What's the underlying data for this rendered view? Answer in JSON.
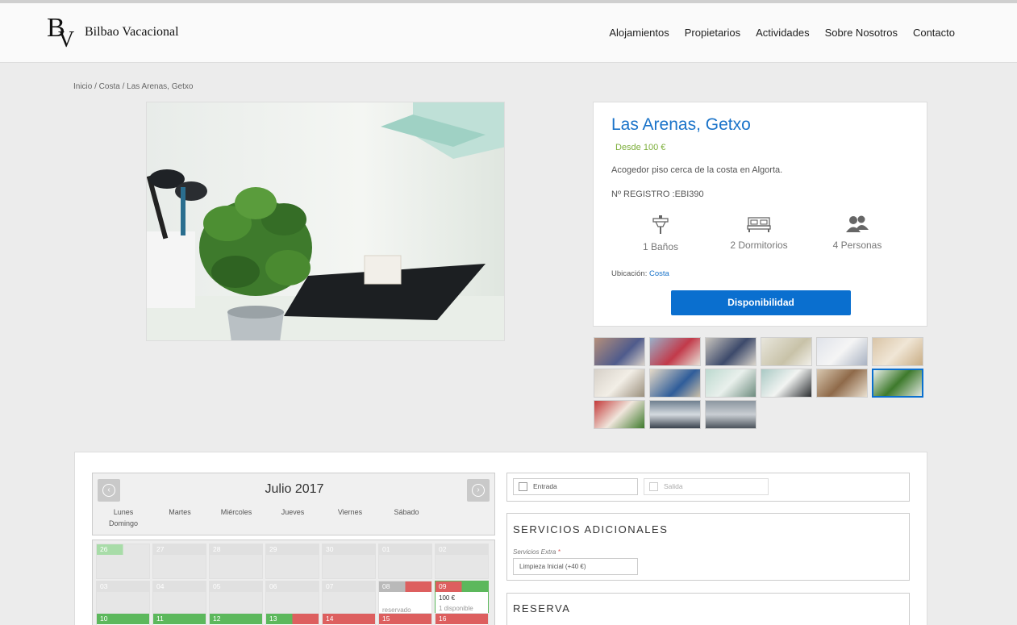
{
  "brand": {
    "logo_letters": "BV",
    "name": "Bilbao Vacacional"
  },
  "nav": [
    "Alojamientos",
    "Propietarios",
    "Actividades",
    "Sobre Nosotros",
    "Contacto"
  ],
  "breadcrumb": "Inicio / Costa / Las Arenas, Getxo",
  "property": {
    "title": "Las Arenas, Getxo",
    "price": "Desde 100 €",
    "description": "Acogedor piso cerca de la costa en Algorta.",
    "registry": "Nº REGISTRO :EBI390",
    "features": {
      "baths": "1 Baños",
      "bedrooms": "2 Dormitorios",
      "persons": "4 Personas"
    },
    "location_label": "Ubicación:",
    "location_value": "Costa",
    "availability_button": "Disponibilidad"
  },
  "calendar": {
    "month": "Julio 2017",
    "weekdays": [
      "Lunes",
      "Martes",
      "Miércoles",
      "Jueves",
      "Viernes",
      "Sábado",
      "Domingo"
    ],
    "row1": [
      "26",
      "27",
      "28",
      "29",
      "30",
      "01",
      "02"
    ],
    "row2": [
      "03",
      "04",
      "05",
      "06",
      "07",
      "08",
      "09"
    ],
    "row3": [
      "10",
      "11",
      "12",
      "13",
      "14",
      "15",
      "16"
    ],
    "day09_price": "100 €",
    "day09_avail": "1 disponible",
    "day08_status": "reservado"
  },
  "booking": {
    "checkin_placeholder": "Entrada",
    "checkout_placeholder": "Salida",
    "services_title": "SERVICIOS ADICIONALES",
    "extra_label": "Servicios Extra",
    "extra_required": "*",
    "extra_value": "Limpieza Inicial (+40 €)",
    "reserva_title": "RESERVA"
  },
  "colors": {
    "accent": "#0a6fcf",
    "title": "#1a73c9",
    "price": "#7cae3a",
    "available": "#5cb85c",
    "booked": "#dd5f5f"
  }
}
